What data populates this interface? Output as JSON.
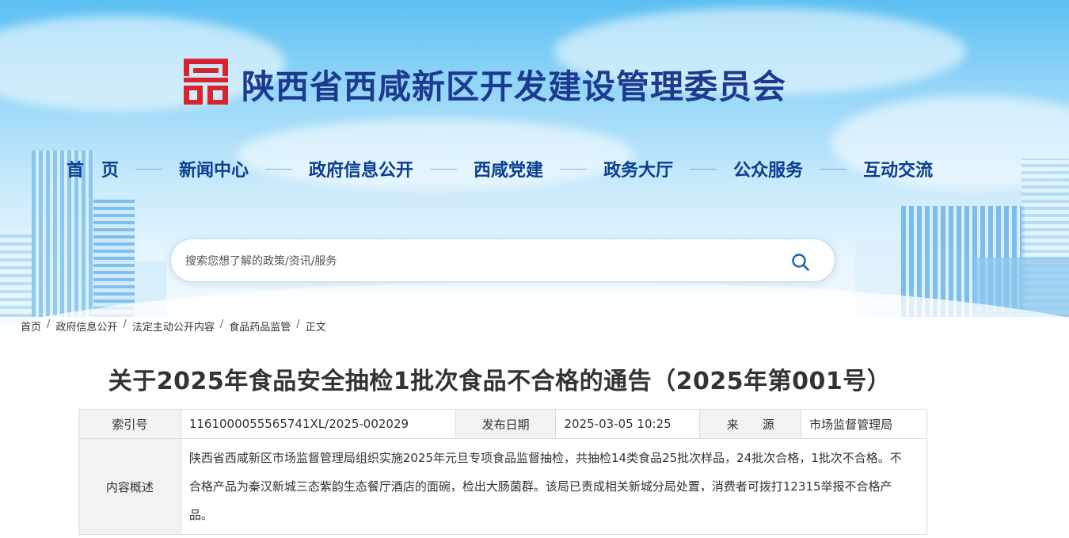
{
  "site": {
    "title": "陕西省西咸新区开发建设管理委员会",
    "logo_icon": "xixian-seal-logo",
    "brand_color": "#d9232d",
    "title_color": "#1d3a8f"
  },
  "nav": {
    "items": [
      {
        "label": "首　页"
      },
      {
        "label": "新闻中心"
      },
      {
        "label": "政府信息公开"
      },
      {
        "label": "西咸党建"
      },
      {
        "label": "政务大厅"
      },
      {
        "label": "公众服务"
      },
      {
        "label": "互动交流"
      }
    ]
  },
  "search": {
    "placeholder": "搜索您想了解的政策/资讯/服务",
    "icon": "search-icon"
  },
  "breadcrumb": {
    "items": [
      {
        "label": "首页"
      },
      {
        "label": "政府信息公开"
      },
      {
        "label": "法定主动公开内容"
      },
      {
        "label": "食品药品监管"
      },
      {
        "label": "正文"
      }
    ],
    "separator": "/"
  },
  "article": {
    "title": "关于2025年食品安全抽检1批次食品不合格的通告（2025年第001号）",
    "meta": {
      "index_label": "索引号",
      "index_value": "1161000055565741XL/2025-002029",
      "date_label": "发布日期",
      "date_value": "2025-03-05 10:25",
      "source_label": "来　　源",
      "source_value": "市场监督管理局",
      "summary_label": "内容概述",
      "summary_value": "陕西省西咸新区市场监督管理局组织实施2025年元旦专项食品监督抽检，共抽检14类食品25批次样品，24批次合格，1批次不合格。不合格产品为秦汉新城三态紫韵生态餐厅酒店的面碗，检出大肠菌群。该局已责成相关新城分局处置，消费者可拨打12315举报不合格产品。"
    }
  }
}
